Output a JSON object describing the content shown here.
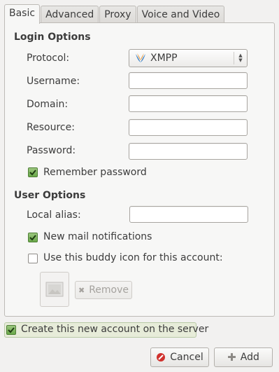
{
  "tabs": [
    "Basic",
    "Advanced",
    "Proxy",
    "Voice and Video"
  ],
  "login_options": {
    "title": "Login Options",
    "protocol_label": "Protocol:",
    "protocol_value": "XMPP",
    "username_label": "Username:",
    "username_value": "",
    "domain_label": "Domain:",
    "domain_value": "",
    "resource_label": "Resource:",
    "resource_value": "",
    "password_label": "Password:",
    "password_value": "",
    "remember_password_label": "Remember password",
    "remember_password_checked": true
  },
  "user_options": {
    "title": "User Options",
    "local_alias_label": "Local alias:",
    "local_alias_value": "",
    "new_mail_label": "New mail notifications",
    "new_mail_checked": true,
    "buddy_icon_label": "Use this buddy icon for this account:",
    "buddy_icon_checked": false,
    "remove_label": "Remove"
  },
  "create_account_label": "Create this new account on the server",
  "create_account_checked": true,
  "buttons": {
    "cancel": "Cancel",
    "add": "Add"
  },
  "colors": {
    "check_green": "#6aa84a",
    "cancel_red": "#d0312d",
    "highlight": "#e7ecd9"
  },
  "icons": {
    "protocol": "xmpp-icon",
    "remove": "remove-x-icon",
    "cancel": "cancel-icon",
    "add": "add-plus-icon",
    "buddy": "image-placeholder-icon"
  }
}
